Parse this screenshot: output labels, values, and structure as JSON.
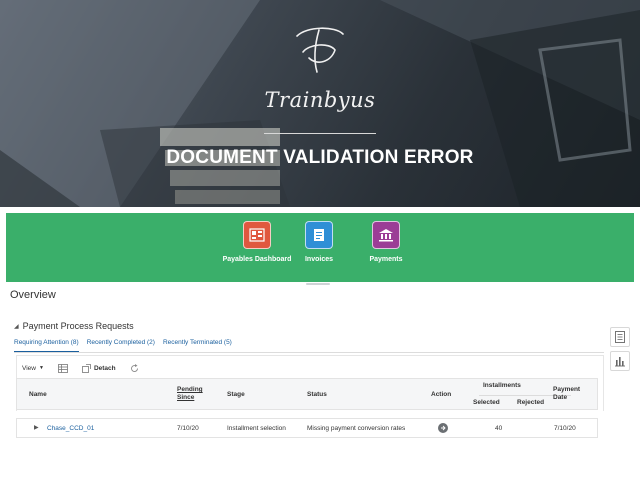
{
  "banner": {
    "brand": "Trainbyus",
    "headline": "DOCUMENT VALIDATION ERROR"
  },
  "nav": {
    "tiles": [
      {
        "label": "Payables Dashboard",
        "icon": "dashboard-icon",
        "color": "#e0583f"
      },
      {
        "label": "Invoices",
        "icon": "invoice-icon",
        "color": "#2f8fd6"
      },
      {
        "label": "Payments",
        "icon": "bank-icon",
        "color": "#9b3d96"
      }
    ]
  },
  "page": {
    "title": "Overview",
    "section_title": "Payment Process Requests"
  },
  "tabs": [
    {
      "label": "Requiring Attention (8)",
      "active": true
    },
    {
      "label": "Recently Completed (2)",
      "active": false
    },
    {
      "label": "Recently Terminated (5)",
      "active": false
    }
  ],
  "toolbar": {
    "view_label": "View",
    "detach_label": "Detach"
  },
  "table": {
    "headers": {
      "name": "Name",
      "pending_since": "Pending Since",
      "stage": "Stage",
      "status": "Status",
      "action": "Action",
      "installments": "Installments",
      "selected": "Selected",
      "rejected": "Rejected",
      "payment_date": "Payment Date"
    },
    "rows": [
      {
        "name": "Chase_CCD_01",
        "pending_since": "7/10/20",
        "stage": "Installment selection",
        "status": "Missing payment conversion rates",
        "selected": "40",
        "rejected": "",
        "payment_date": "7/10/20"
      }
    ]
  }
}
